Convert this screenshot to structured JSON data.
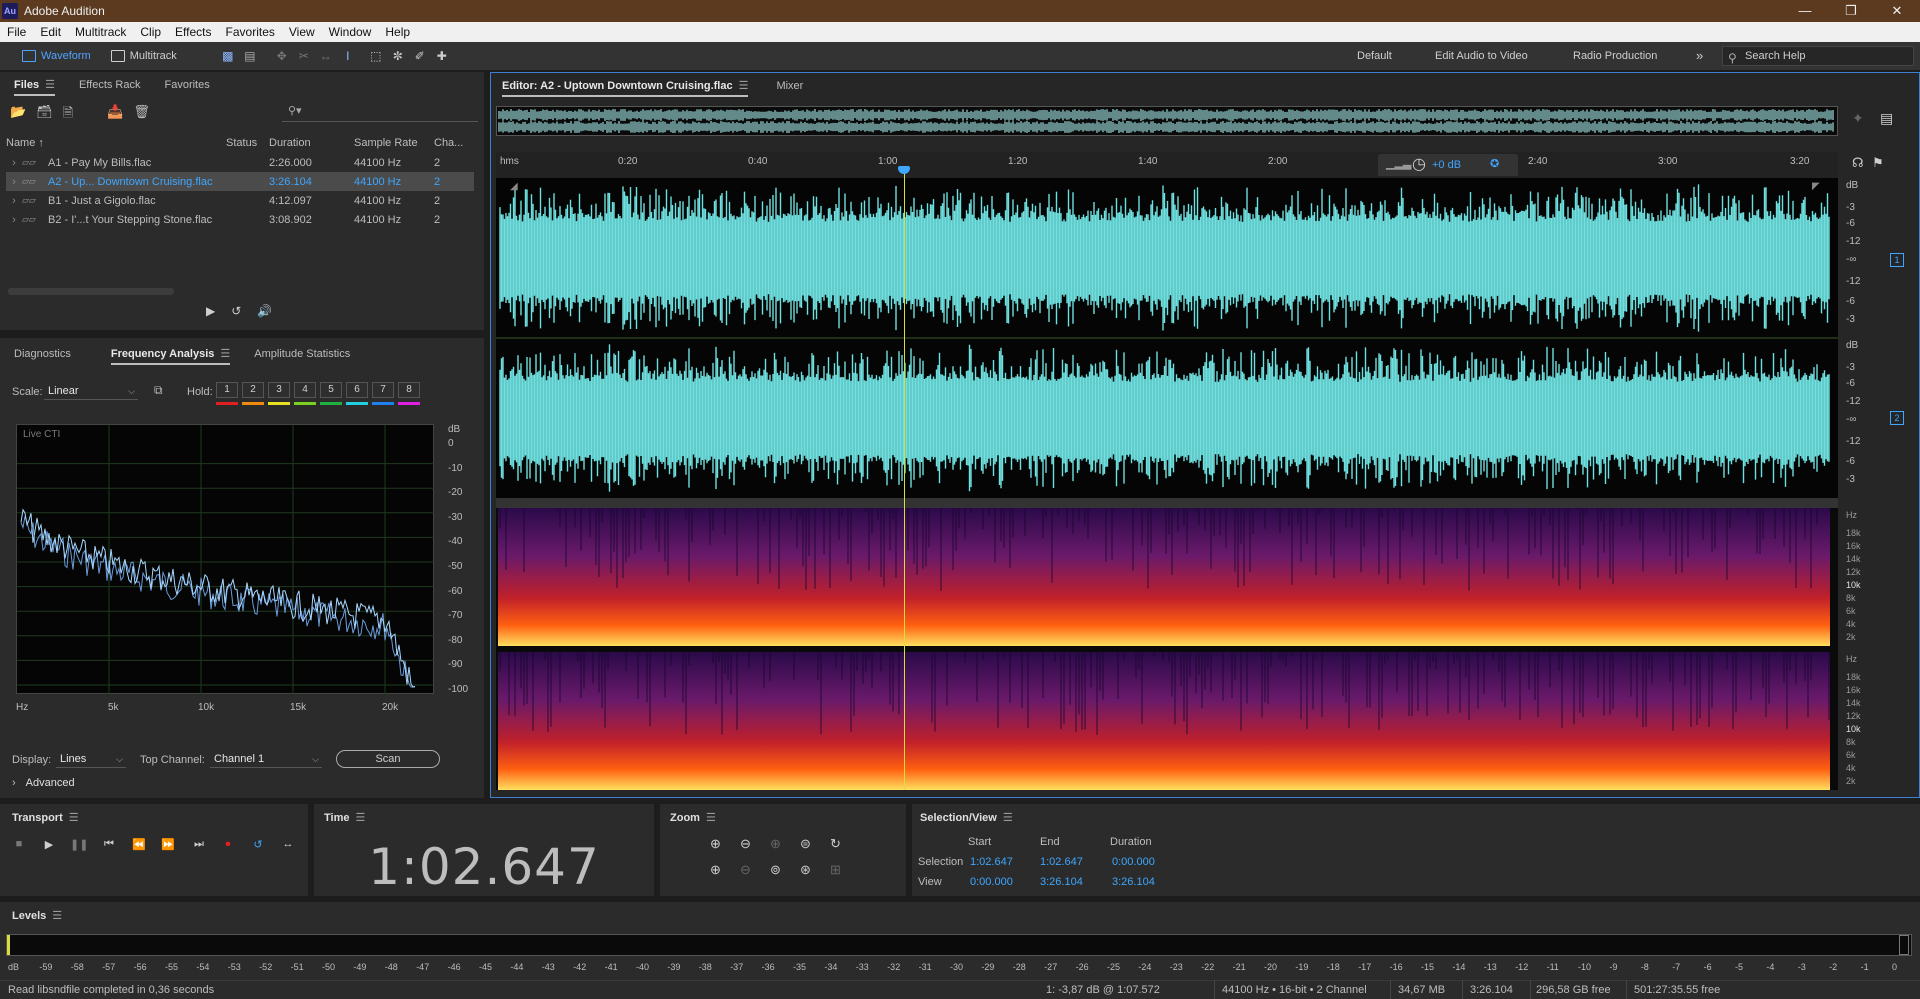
{
  "window": {
    "title": "Adobe Audition",
    "logo": "Au"
  },
  "menu": [
    "File",
    "Edit",
    "Multitrack",
    "Clip",
    "Effects",
    "Favorites",
    "View",
    "Window",
    "Help"
  ],
  "toolbar": {
    "waveform": "Waveform",
    "multitrack": "Multitrack"
  },
  "workspaces": [
    "Default",
    "Edit Audio to Video",
    "Radio Production"
  ],
  "search_help": "Search Help",
  "files_panel": {
    "tabs": [
      "Files",
      "Effects Rack",
      "Favorites"
    ],
    "columns": [
      "Name",
      "Status",
      "Duration",
      "Sample Rate",
      "Cha..."
    ],
    "rows": [
      {
        "name": "A1 - Pay My Bills.flac",
        "status": "",
        "duration": "2:26.000",
        "rate": "44100 Hz",
        "ch": "2"
      },
      {
        "name": "A2 - Up... Downtown Cruising.flac",
        "status": "",
        "duration": "3:26.104",
        "rate": "44100 Hz",
        "ch": "2"
      },
      {
        "name": "B1 - Just a Gigolo.flac",
        "status": "",
        "duration": "4:12.097",
        "rate": "44100 Hz",
        "ch": "2"
      },
      {
        "name": "B2 - I'...t Your Stepping Stone.flac",
        "status": "",
        "duration": "3:08.902",
        "rate": "44100 Hz",
        "ch": "2"
      }
    ]
  },
  "analysis_panel": {
    "tabs": [
      "Diagnostics",
      "Frequency Analysis",
      "Amplitude Statistics"
    ],
    "scale_label": "Scale:",
    "scale_value": "Linear",
    "hold_label": "Hold:",
    "hold_buttons": [
      "1",
      "2",
      "3",
      "4",
      "5",
      "6",
      "7",
      "8"
    ],
    "hold_colors": [
      "#e02020",
      "#f08a10",
      "#e6e020",
      "#7ad020",
      "#20b040",
      "#20d0e0",
      "#2080f0",
      "#e020e0"
    ],
    "graph_label": "Live CTI",
    "db_ticks": [
      "dB",
      "0",
      "-10",
      "-20",
      "-30",
      "-40",
      "-50",
      "-60",
      "-70",
      "-80",
      "-90",
      "-100"
    ],
    "hz_ticks": [
      "Hz",
      "5k",
      "10k",
      "15k",
      "20k"
    ],
    "display_label": "Display:",
    "display_value": "Lines",
    "top_channel_label": "Top Channel:",
    "top_channel_value": "Channel 1",
    "scan": "Scan",
    "advanced": "Advanced"
  },
  "editor": {
    "tabs": [
      "Editor: A2 - Uptown Downtown Cruising.flac",
      "Mixer"
    ],
    "ruler_unit": "hms",
    "ruler_ticks": [
      "0:20",
      "0:40",
      "1:00",
      "1:20",
      "1:40",
      "2:00",
      "2:40",
      "3:00",
      "3:20"
    ],
    "gain": "+0 dB",
    "db_scale": [
      "dB",
      "-3",
      "-6",
      "-12",
      "-∞",
      "-12",
      "-6",
      "-3"
    ],
    "hz_scale": [
      "Hz",
      "18k",
      "16k",
      "14k",
      "12k",
      "10k",
      "8k",
      "6k",
      "4k",
      "2k"
    ],
    "channel_badges": [
      "1",
      "2"
    ]
  },
  "transport": {
    "label": "Transport"
  },
  "time": {
    "label": "Time",
    "value": "1:02.647"
  },
  "zoom": {
    "label": "Zoom"
  },
  "selection_view": {
    "label": "Selection/View",
    "headers": [
      "Start",
      "End",
      "Duration"
    ],
    "rows": [
      {
        "label": "Selection",
        "start": "1:02.647",
        "end": "1:02.647",
        "duration": "0:00.000"
      },
      {
        "label": "View",
        "start": "0:00.000",
        "end": "3:26.104",
        "duration": "3:26.104"
      }
    ]
  },
  "levels": {
    "label": "Levels",
    "ticks": [
      "dB",
      "-59",
      "-58",
      "-57",
      "-56",
      "-55",
      "-54",
      "-53",
      "-52",
      "-51",
      "-50",
      "-49",
      "-48",
      "-47",
      "-46",
      "-45",
      "-44",
      "-43",
      "-42",
      "-41",
      "-40",
      "-39",
      "-38",
      "-37",
      "-36",
      "-35",
      "-34",
      "-33",
      "-32",
      "-31",
      "-30",
      "-29",
      "-28",
      "-27",
      "-26",
      "-25",
      "-24",
      "-23",
      "-22",
      "-21",
      "-20",
      "-19",
      "-18",
      "-17",
      "-16",
      "-15",
      "-14",
      "-13",
      "-12",
      "-11",
      "-10",
      "-9",
      "-8",
      "-7",
      "-6",
      "-5",
      "-4",
      "-3",
      "-2",
      "-1",
      "0"
    ]
  },
  "status": {
    "left": "Read libsndfile completed in 0,36 seconds",
    "cursor": "1: -3,87 dB @ 1:07.572",
    "format": "44100 Hz • 16-bit • 2 Channel",
    "size": "34,67 MB",
    "duration": "3:26.104",
    "free": "296,58 GB free",
    "time_free": "501:27:35.55 free"
  }
}
